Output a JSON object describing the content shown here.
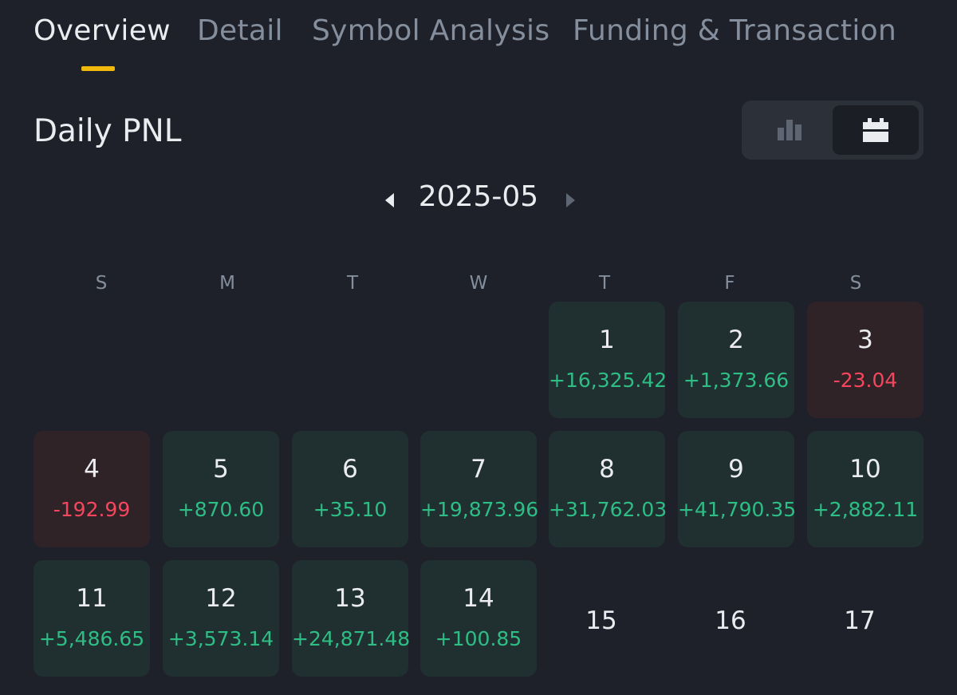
{
  "tabs": [
    {
      "label": "Overview",
      "active": true
    },
    {
      "label": "Detail",
      "active": false
    },
    {
      "label": "Symbol Analysis",
      "active": false
    },
    {
      "label": "Funding & Transaction",
      "active": false
    }
  ],
  "section_title": "Daily PNL",
  "view_toggle": {
    "options": [
      "bar-chart-icon",
      "calendar-icon"
    ],
    "selected": "calendar-icon"
  },
  "month": "2025-05",
  "weekdays": [
    "S",
    "M",
    "T",
    "W",
    "T",
    "F",
    "S"
  ],
  "days": [
    {
      "day": "1",
      "pnl": "+16,325.42"
    },
    {
      "day": "2",
      "pnl": "+1,373.66"
    },
    {
      "day": "3",
      "pnl": "-23.04"
    },
    {
      "day": "4",
      "pnl": "-192.99"
    },
    {
      "day": "5",
      "pnl": "+870.60"
    },
    {
      "day": "6",
      "pnl": "+35.10"
    },
    {
      "day": "7",
      "pnl": "+19,873.96"
    },
    {
      "day": "8",
      "pnl": "+31,762.03"
    },
    {
      "day": "9",
      "pnl": "+41,790.35"
    },
    {
      "day": "10",
      "pnl": "+2,882.11"
    },
    {
      "day": "11",
      "pnl": "+5,486.65"
    },
    {
      "day": "12",
      "pnl": "+3,573.14"
    },
    {
      "day": "13",
      "pnl": "+24,871.48"
    },
    {
      "day": "14",
      "pnl": "+100.85"
    },
    {
      "day": "15",
      "pnl": ""
    },
    {
      "day": "16",
      "pnl": ""
    },
    {
      "day": "17",
      "pnl": ""
    }
  ],
  "colors": {
    "positive": "#2ebd85",
    "negative": "#f6465d",
    "accent": "#f0b90b"
  }
}
